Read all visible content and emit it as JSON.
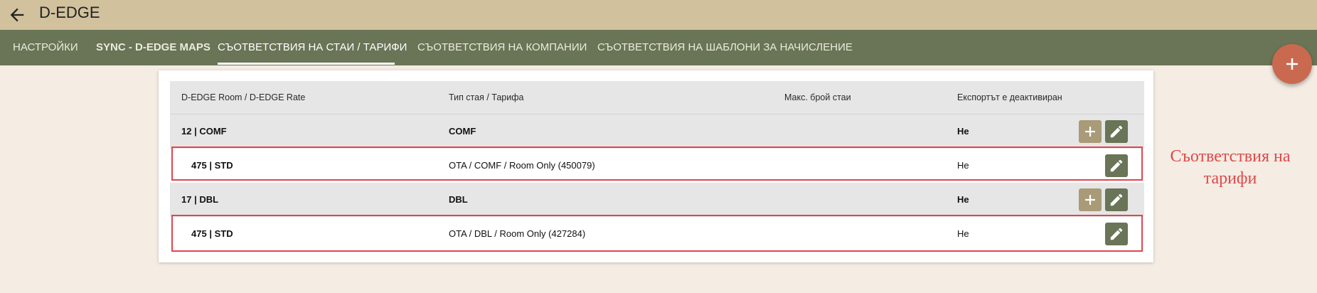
{
  "app": {
    "title": "D-EDGE"
  },
  "tabs": [
    {
      "label": "НАСТРОЙКИ"
    },
    {
      "label": "SYNC - D-EDGE MAPS"
    },
    {
      "label": "СЪОТВЕТСТВИЯ НА СТАИ / ТАРИФИ"
    },
    {
      "label": "СЪОТВЕТСТВИЯ НА КОМПАНИИ"
    },
    {
      "label": "СЪОТВЕТСТВИЯ НА ШАБЛОНИ ЗА НАЧИСЛЕНИЕ"
    }
  ],
  "active_tab": "СЪОТВЕТСТВИЯ НА СТАИ / ТАРИФИ",
  "table": {
    "headers": [
      "D-EDGE Room / D-EDGE Rate",
      "Тип стая / Тарифа",
      "Макс. брой стаи",
      "Експортът е деактивиран"
    ],
    "rows": [
      {
        "kind": "room",
        "dedge_id": "12",
        "dedge_code": "COMF",
        "mapping": "COMF",
        "max_rooms": "",
        "export_disabled": "Не"
      },
      {
        "kind": "rate",
        "dedge_id": "475",
        "dedge_code": "STD",
        "mapping": "OTA / COMF / Room Only (450079)",
        "max_rooms": "",
        "export_disabled": "Не"
      },
      {
        "kind": "room",
        "dedge_id": "17",
        "dedge_code": "DBL",
        "mapping": "DBL",
        "max_rooms": "",
        "export_disabled": "Не"
      },
      {
        "kind": "rate",
        "dedge_id": "475",
        "dedge_code": "STD",
        "mapping": "OTA / DBL / Room Only (427284)",
        "max_rooms": "",
        "export_disabled": "Не"
      }
    ]
  },
  "annotation": {
    "line1": "Съответствия на",
    "line2": "тарифи",
    "color": "#dd4a4a"
  },
  "colors": {
    "topbar": "#d1c19d",
    "tabbar": "#6a7456",
    "fab": "#c96a50",
    "add_button": "#a99a78",
    "edit_button": "#6a7456",
    "page_bg": "#f5ece3"
  },
  "icons": {
    "back": "arrow-left-icon",
    "fab": "plus-icon",
    "add": "plus-icon",
    "edit": "pencil-icon"
  }
}
